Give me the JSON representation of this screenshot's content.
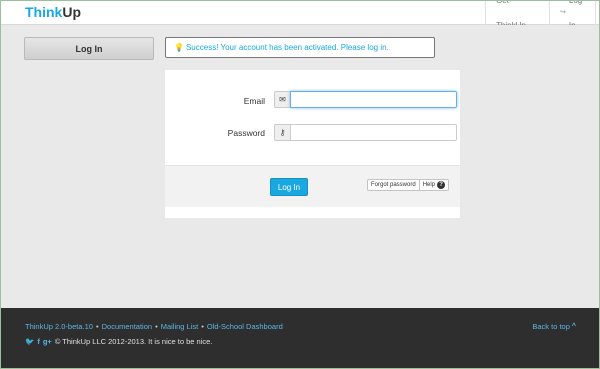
{
  "navbar": {
    "brand_part1": "Think",
    "brand_part2": "Up",
    "get_thinkup": "Get ThinkUp",
    "login": "Log In",
    "login_icon": "↪"
  },
  "sidebar": {
    "login_button": "Log In"
  },
  "alert": {
    "icon": "💡",
    "message": "Success! Your account has been activated. Please log in."
  },
  "form": {
    "email_label": "Email",
    "email_value": "",
    "email_icon": "✉",
    "password_label": "Password",
    "password_value": "",
    "password_icon": "⚷",
    "submit": "Log In",
    "forgot_password": "Forgot password",
    "help": "Help",
    "help_icon": "?"
  },
  "footer": {
    "version": "ThinkUp 2.0-beta.10",
    "documentation": "Documentation",
    "mailing_list": "Mailing List",
    "dashboard": "Old-School Dashboard",
    "separator": "•",
    "back_to_top": "Back to top",
    "chevron": "^",
    "twitter": "🐦",
    "facebook": "f",
    "google": "g+",
    "copyright": "© ThinkUp LLC 2012-2013. It is nice to be nice."
  },
  "colors": {
    "accent": "#19a8e0",
    "footer_bg": "#2e2e2e",
    "page_bg": "#e9e9e9"
  }
}
